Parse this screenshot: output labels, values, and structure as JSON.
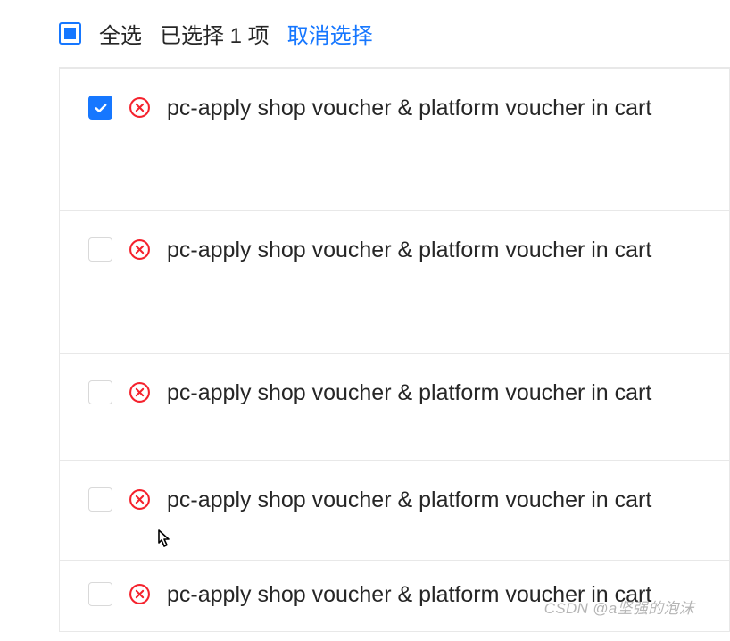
{
  "header": {
    "select_all_label": "全选",
    "selected_count_text": "已选择 1 项",
    "cancel_label": "取消选择"
  },
  "items": [
    {
      "checked": true,
      "title": "pc-apply shop voucher & platform voucher in cart"
    },
    {
      "checked": false,
      "title": "pc-apply shop voucher & platform voucher in cart"
    },
    {
      "checked": false,
      "title": "pc-apply shop voucher & platform voucher in cart"
    },
    {
      "checked": false,
      "title": "pc-apply shop voucher & platform voucher in cart"
    },
    {
      "checked": false,
      "title": "pc-apply shop voucher & platform voucher in cart"
    }
  ],
  "watermark": "CSDN @a坚强的泡沫"
}
